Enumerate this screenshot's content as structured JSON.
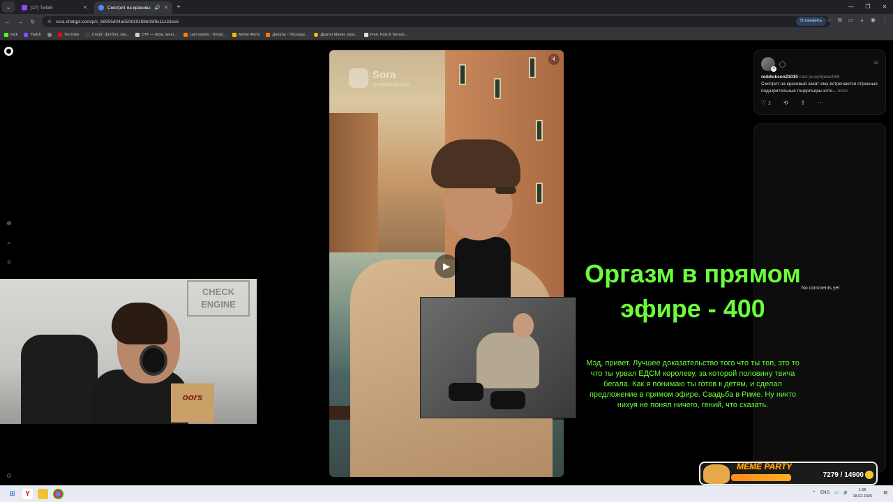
{
  "browser": {
    "tabs": [
      {
        "title": "(27) Twitch",
        "active": false,
        "favicon_color": "#9146ff"
      },
      {
        "title": "Смотрит на красивый зак...",
        "active": true,
        "favicon_color": "#4a8cff"
      }
    ],
    "url": "sora.chatgpt.com/p/s_69905d04a050819188b05f8c11c33ec6",
    "install_label": "Установить",
    "bookmarks": [
      {
        "label": "Kick",
        "color": "#53fc18"
      },
      {
        "label": "Twitch",
        "color": "#9146ff"
      },
      {
        "label": "",
        "color": "#888888"
      },
      {
        "label": "YouTube",
        "color": "#ff0000"
      },
      {
        "label": "Спорт: футбол, хок...",
        "color": "#444444"
      },
      {
        "label": "DTF — игры, кино...",
        "color": "#cccccc"
      },
      {
        "label": "Last events - Donat...",
        "color": "#f57c00"
      },
      {
        "label": "Meme Alerts",
        "color": "#f5b400"
      },
      {
        "label": "Донаты - Последн...",
        "color": "#f57c00"
      },
      {
        "label": "Драгон Манис игра...",
        "color": "#f5c400"
      },
      {
        "label": "Free, Fast & Secure...",
        "color": "#dddddd"
      }
    ]
  },
  "video": {
    "watermark_name": "Sora",
    "watermark_user": "@reddickson21010"
  },
  "post": {
    "username": "reddickson21010",
    "cast_label": "cast josephpeach88",
    "time": "3d",
    "text": "Смотрит на красивый закат ему встречаются странные подозрительные гондольеры кото...",
    "more_label": "more",
    "likes": "2"
  },
  "comments": {
    "empty_label": "No comments yet"
  },
  "webcam": {
    "sign": "CHECK ENGINE",
    "box_text": "oors"
  },
  "donation": {
    "title": "Оргазм в прямом эфире - 400",
    "message": "Мэд, привет. Лучшее доказательство того что ты топ, это то что ты урвал ЕДСМ королеву, за которой половину твича бегала. Как я понимаю ты готов к детям, и сделал предложение в прямом эфире. Свадьба в Риме. Ну никто нихуя не понял ничего, гений, что сказать."
  },
  "meme_party": {
    "title": "MEME PARTY",
    "progress_text": "7279 / 14900",
    "progress_fraction": 0.49
  },
  "taskbar": {
    "lang": "ENG",
    "time": "1:06",
    "date": "18.02.2026"
  },
  "colors": {
    "donation_green": "#6bff3a",
    "page_bg": "#000000"
  }
}
